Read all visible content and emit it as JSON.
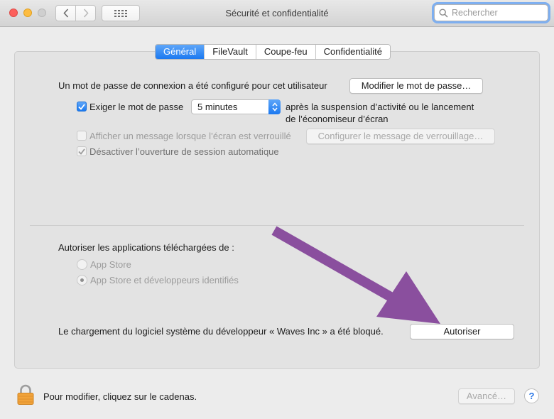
{
  "window": {
    "title": "Sécurité et confidentialité",
    "search_placeholder": "Rechercher"
  },
  "tabs": [
    {
      "label": "Général",
      "active": true
    },
    {
      "label": "FileVault",
      "active": false
    },
    {
      "label": "Coupe-feu",
      "active": false
    },
    {
      "label": "Confidentialité",
      "active": false
    }
  ],
  "general": {
    "password_text": "Un mot de passe de connexion a été configuré pour cet utilisateur",
    "change_password_button": "Modifier le mot de passe…",
    "require_password": {
      "checked": true,
      "label": "Exiger le mot de passe",
      "selected_option": "5 minutes",
      "after_text_line1": "après la suspension d’activité ou le lancement",
      "after_text_line2": "de l’économiseur d’écran"
    },
    "show_message": {
      "checked": false,
      "label": "Afficher un message lorsque l’écran est verrouillé",
      "button": "Configurer le message de verrouillage…"
    },
    "disable_auto_login": {
      "checked": true,
      "label": "Désactiver l’ouverture de session automatique"
    },
    "allow_apps": {
      "label": "Autoriser les applications téléchargées de :",
      "options": [
        {
          "label": "App Store",
          "selected": false
        },
        {
          "label": "App Store et développeurs identifiés",
          "selected": true
        }
      ]
    },
    "blocked": {
      "text": "Le chargement du logiciel système du développeur « Waves Inc » a été bloqué.",
      "button": "Autoriser"
    }
  },
  "footer": {
    "lock_text": "Pour modifier, cliquez sur le cadenas.",
    "advanced_button": "Avancé…",
    "help_label": "?"
  },
  "colors": {
    "accent": "#1b79f0",
    "annotation_arrow": "#8a4f9e"
  }
}
